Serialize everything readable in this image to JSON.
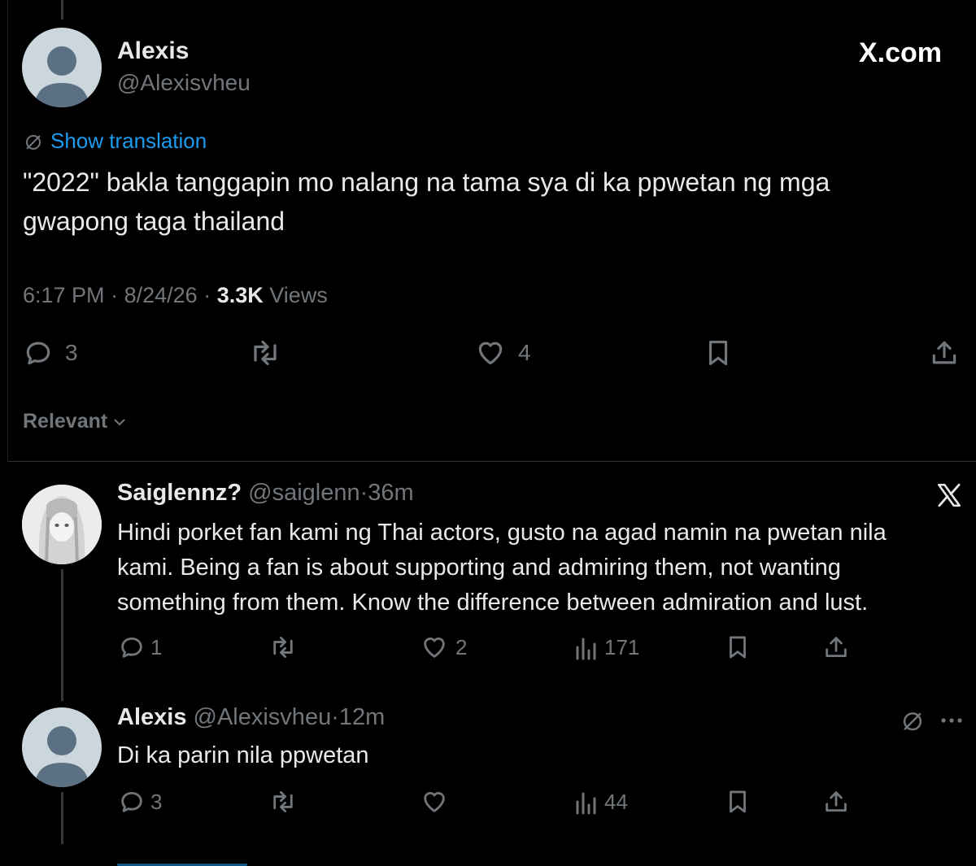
{
  "brand": {
    "site": "X.com"
  },
  "main_post": {
    "display_name": "Alexis",
    "handle": "@Alexisvheu",
    "translate_label": "Show translation",
    "text_line1": "\"2022\" bakla tanggapin mo nalang na tama sya di ka ppwetan ng mga",
    "text_line2": "gwapong taga thailand",
    "time": "6:17 PM",
    "date": "8/24/26",
    "sep": "·",
    "views_count": "3.3K",
    "views_label": "Views",
    "replies": "3",
    "likes": "4"
  },
  "sort": {
    "label": "Relevant"
  },
  "reply1": {
    "display_name": "Saiglennz?",
    "handle": "@saiglenn",
    "age": "36m",
    "sep": "·",
    "text_line1": "Hindi porket fan kami ng Thai actors, gusto na agad namin na pwetan nila",
    "text_line2": "kami. Being a fan is about supporting and admiring them, not wanting",
    "text_line3": "something from them. Know the difference between admiration and lust.",
    "replies": "1",
    "likes": "2",
    "views": "171"
  },
  "reply2": {
    "display_name": "Alexis",
    "handle": "@Alexisvheu",
    "age": "12m",
    "sep": "·",
    "text": "Di ka parin nila ppwetan",
    "replies": "3",
    "views": "44"
  },
  "icons": {
    "reply": "reply-icon",
    "repost": "repost-icon",
    "like": "heart-icon",
    "bookmark": "bookmark-icon",
    "share": "share-icon",
    "views": "views-icon",
    "translate": "translate-icon",
    "more": "more-icon",
    "x_logo": "x-logo-icon"
  },
  "colors": {
    "background": "#000000",
    "text": "#e7e9ea",
    "muted": "#71767b",
    "link": "#1d9bf0",
    "divider": "#2f3336"
  }
}
